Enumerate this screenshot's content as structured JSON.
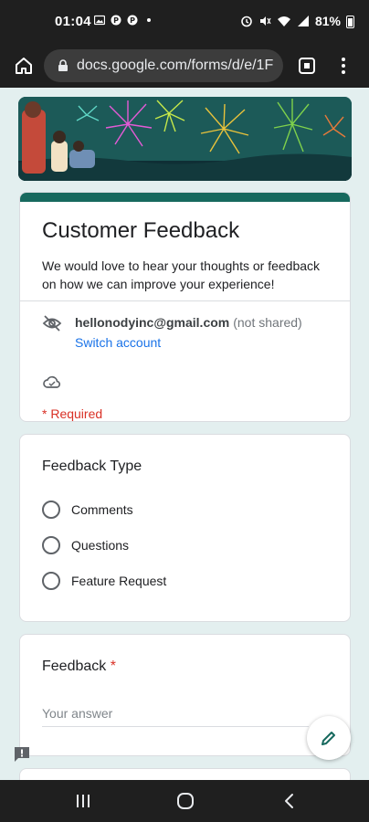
{
  "status_bar": {
    "time": "01:04",
    "battery_pct": "81%",
    "left_icons": [
      "image-icon",
      "pinterest-icon",
      "pinterest-icon",
      "dot-icon"
    ],
    "right_icons": [
      "alarm-icon",
      "mute-icon",
      "wifi-icon",
      "signal-icon",
      "battery-icon"
    ]
  },
  "browser": {
    "url": "docs.google.com/forms/d/e/1F",
    "home_icon": "home-icon",
    "lock_icon": "lock-icon",
    "tabs_icon": "tabs-icon",
    "menu_icon": "more-vert-icon"
  },
  "form": {
    "title": "Customer Feedback",
    "description": "We would love to hear your thoughts or feedback on how we can improve your experience!",
    "account": {
      "email": "hellonodyinc@gmail.com",
      "not_shared": "(not shared)",
      "switch_label": "Switch account"
    },
    "required_note": "* Required",
    "questions": [
      {
        "title": "Feedback Type",
        "options": [
          "Comments",
          "Questions",
          "Feature Request"
        ]
      },
      {
        "title": "Feedback",
        "required_mark": "*",
        "placeholder": "Your answer"
      }
    ]
  },
  "colors": {
    "theme": "#17695e",
    "background": "#e3efef",
    "link": "#1a73e8",
    "required": "#d93025"
  },
  "nav_bar": {
    "icons": [
      "recent-apps-icon",
      "home-circle-icon",
      "back-icon"
    ]
  }
}
